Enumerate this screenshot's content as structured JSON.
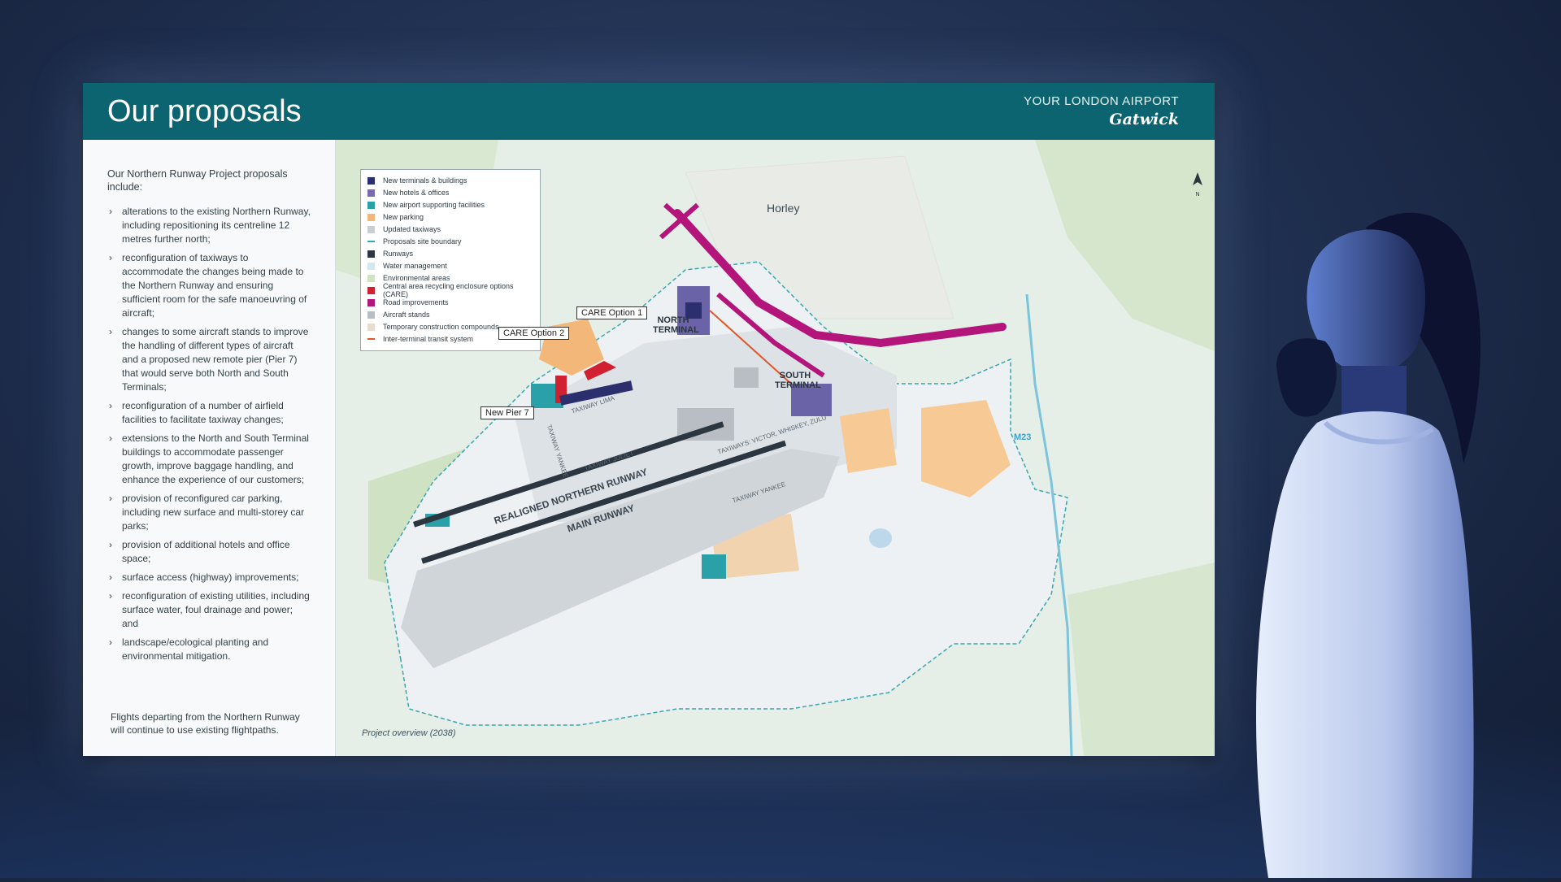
{
  "board": {
    "title": "Our proposals",
    "brand_top": "YOUR LONDON AIRPORT",
    "brand_logo": "Gatwick"
  },
  "panel": {
    "intro": "Our Northern Runway Project proposals include:",
    "bullets": [
      "alterations to the existing Northern Runway, including repositioning its centreline 12 metres further north;",
      "reconfiguration of taxiways to accommodate the changes being made to the Northern Runway and ensuring sufficient room for the safe manoeuvring of aircraft;",
      "changes to some aircraft stands to improve the handling of different types of aircraft and a proposed new remote pier (Pier 7) that would serve both North and South Terminals;",
      "reconfiguration of a number of airfield facilities to facilitate taxiway changes;",
      "extensions to the North and South Terminal buildings to accommodate passenger growth, improve baggage handling, and enhance the experience of our customers;",
      "provision of reconfigured car parking, including new surface and multi-storey car parks;",
      "provision of additional hotels and office space;",
      "surface access (highway) improvements;",
      "reconfiguration of existing utilities, including surface water, foul drainage and power; and",
      "landscape/ecological planting and environmental mitigation."
    ],
    "footnote": "Flights departing from the Northern Runway will continue to use existing flightpaths."
  },
  "legend": [
    {
      "label": "New terminals & buildings",
      "color": "#2b2f6e"
    },
    {
      "label": "New hotels & offices",
      "color": "#7a6bb0"
    },
    {
      "label": "New airport supporting facilities",
      "color": "#2aa0a8"
    },
    {
      "label": "New parking",
      "color": "#f3b77a"
    },
    {
      "label": "Updated taxiways",
      "color": "#c9ced3"
    },
    {
      "label": "Proposals site boundary",
      "color": "#3aa6b0"
    },
    {
      "label": "Runways",
      "color": "#2c3640"
    },
    {
      "label": "Water management",
      "color": "#d6e6ef"
    },
    {
      "label": "Environmental areas",
      "color": "#cfe3c4"
    },
    {
      "label": "Central area recycling enclosure options (CARE)",
      "color": "#d1202f"
    },
    {
      "label": "Road improvements",
      "color": "#b3157a"
    },
    {
      "label": "Aircraft stands",
      "color": "#b9bec4"
    },
    {
      "label": "Temporary construction compounds",
      "color": "#e8dccf"
    },
    {
      "label": "Inter-terminal transit system",
      "color": "#e0562a"
    }
  ],
  "map": {
    "town": "Horley",
    "callouts": {
      "care1": "CARE Option 1",
      "care2": "CARE Option 2",
      "pier7": "New Pier 7"
    },
    "north_terminal": "NORTH TERMINAL",
    "south_terminal": "SOUTH TERMINAL",
    "runway_north": "REALIGNED NORTHERN RUNWAY",
    "runway_main": "MAIN RUNWAY",
    "taxiways": {
      "lima": "TAXIWAY LIMA",
      "yankee_v": "TAXIWAY YANKEE",
      "juliet": "TAXIWAY JULIET",
      "vwz": "TAXIWAYS: VICTOR, WHISKEY, ZULU",
      "yankee": "TAXIWAY YANKEE"
    },
    "road": "M23",
    "north_label": "N",
    "caption": "Project overview (2038)"
  }
}
